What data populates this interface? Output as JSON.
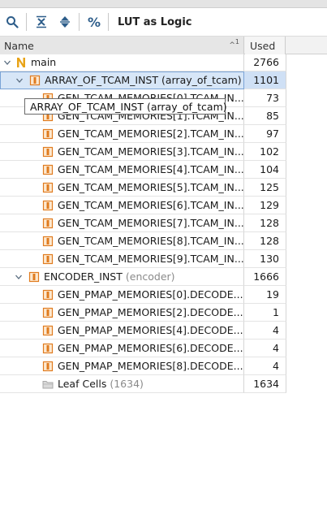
{
  "toolbar": {
    "title": "LUT as Logic",
    "buttons": [
      "search-icon",
      "collapse-all-icon",
      "expand-all-icon",
      "percent-icon"
    ],
    "percent_glyph": "%"
  },
  "table": {
    "columns": {
      "name": "Name",
      "used": "Used",
      "sort_indicator": "^",
      "sort_order": "1"
    },
    "rows": [
      {
        "name": "main",
        "used": "2766",
        "type": "top"
      },
      {
        "name": "ARRAY_OF_TCAM_INST",
        "module": "(array_of_tcam)",
        "used": "1101",
        "type": "hier",
        "selected": true
      },
      {
        "name": "GEN_TCAM_MEMORIES[0].TCAM_IN...",
        "used": "73",
        "type": "leaf"
      },
      {
        "name": "GEN_TCAM_MEMORIES[1].TCAM_IN...",
        "used": "85",
        "type": "leaf"
      },
      {
        "name": "GEN_TCAM_MEMORIES[2].TCAM_IN...",
        "used": "97",
        "type": "leaf"
      },
      {
        "name": "GEN_TCAM_MEMORIES[3].TCAM_IN...",
        "used": "102",
        "type": "leaf"
      },
      {
        "name": "GEN_TCAM_MEMORIES[4].TCAM_IN...",
        "used": "104",
        "type": "leaf"
      },
      {
        "name": "GEN_TCAM_MEMORIES[5].TCAM_IN...",
        "used": "125",
        "type": "leaf"
      },
      {
        "name": "GEN_TCAM_MEMORIES[6].TCAM_IN...",
        "used": "129",
        "type": "leaf"
      },
      {
        "name": "GEN_TCAM_MEMORIES[7].TCAM_IN...",
        "used": "128",
        "type": "leaf"
      },
      {
        "name": "GEN_TCAM_MEMORIES[8].TCAM_IN...",
        "used": "128",
        "type": "leaf"
      },
      {
        "name": "GEN_TCAM_MEMORIES[9].TCAM_IN...",
        "used": "130",
        "type": "leaf"
      },
      {
        "name": "ENCODER_INST",
        "module": "(encoder)",
        "used": "1666",
        "type": "hier"
      },
      {
        "name": "GEN_PMAP_MEMORIES[0].DECODE...",
        "used": "19",
        "type": "leaf"
      },
      {
        "name": "GEN_PMAP_MEMORIES[2].DECODE...",
        "used": "1",
        "type": "leaf"
      },
      {
        "name": "GEN_PMAP_MEMORIES[4].DECODE...",
        "used": "4",
        "type": "leaf"
      },
      {
        "name": "GEN_PMAP_MEMORIES[6].DECODE...",
        "used": "4",
        "type": "leaf"
      },
      {
        "name": "GEN_PMAP_MEMORIES[8].DECODE...",
        "used": "4",
        "type": "leaf"
      },
      {
        "name": "Leaf Cells",
        "module": "(1634)",
        "used": "1634",
        "type": "cells"
      }
    ]
  },
  "tooltip": {
    "text": "ARRAY_OF_TCAM_INST (array_of_tcam)"
  },
  "colors": {
    "selection_bg": "#d7e6f7",
    "selection_border": "#7aa3d6",
    "top_icon": "#e8a317",
    "instance_icon": "#e07b1f",
    "folder_icon": "#b5b5b5",
    "toolbar_icon": "#2d5d8a"
  }
}
